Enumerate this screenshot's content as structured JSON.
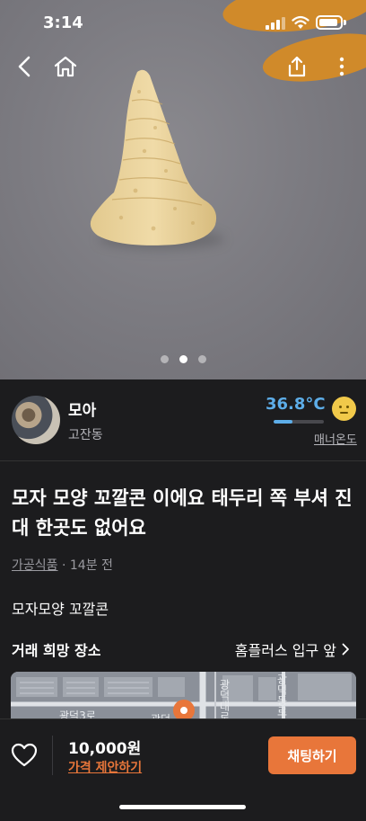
{
  "status_bar": {
    "time": "3:14"
  },
  "photo": {
    "image_count": 3,
    "active_index": 1
  },
  "seller": {
    "name": "모아",
    "location": "고잔동",
    "temperature": "36.8°C",
    "temperature_level": 0.37,
    "manner_label": "매너온도"
  },
  "post": {
    "title": "모자 모양 꼬깔콘 이에요 태두리 쪽 부셔 진대 한곳도 없어요",
    "category": "가공식품",
    "time_ago": "· 14분 전",
    "description": "모자모양 꼬깔콘"
  },
  "trade_place": {
    "label": "거래 희망 장소",
    "value": "홈플러스 입구 앞",
    "map_labels": [
      "광덕3로",
      "광덕대로",
      "광덕동로",
      "광덕"
    ]
  },
  "bottom_bar": {
    "price": "10,000원",
    "offer_label": "가격 제안하기",
    "chat_label": "채팅하기"
  },
  "colors": {
    "accent": "#e8763a",
    "temperature": "#5dade8",
    "background": "#1c1c1e"
  }
}
